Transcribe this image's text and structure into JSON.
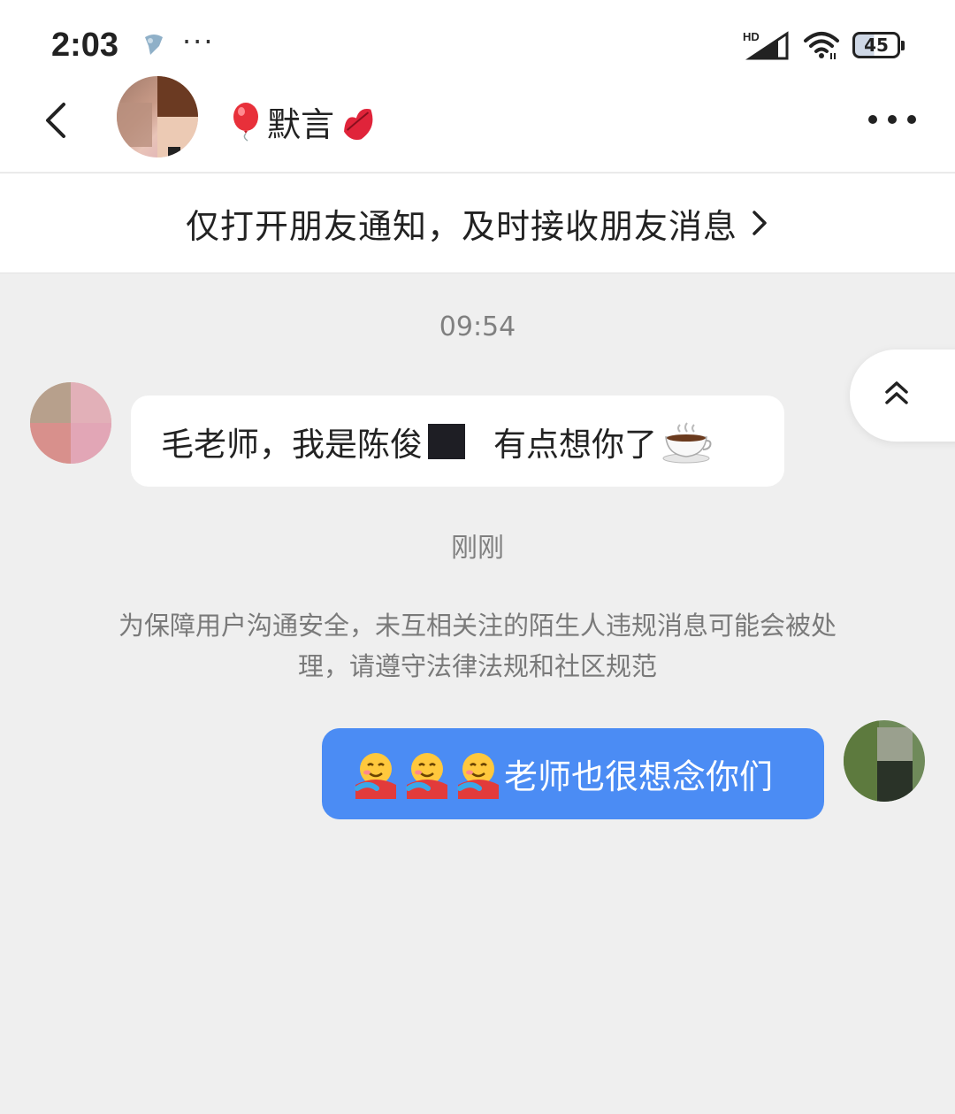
{
  "status_bar": {
    "time": "2:03",
    "more": "···",
    "network_label": "HD",
    "battery": "45"
  },
  "header": {
    "contact_name": "默言",
    "name_prefix_icon": "balloon-emoji",
    "name_suffix_icon": "lips-emoji"
  },
  "notice_bar": {
    "text": "仅打开朋友通知，及时接收朋友消息"
  },
  "chat": {
    "timestamp_1": "09:54",
    "incoming": {
      "text_before": "毛老师，我是陈俊",
      "text_after": "有点想你了",
      "trailing_icon": "hot-beverage-emoji"
    },
    "timestamp_2": "刚刚",
    "system_notice": "为保障用户沟通安全，未互相关注的陌生人违规消息可能会被处理，请遵守法律法规和社区规范",
    "outgoing": {
      "leading_icons": [
        "smiling-face-with-hearts-hug-emoji",
        "smiling-face-with-hearts-hug-emoji",
        "smiling-face-with-hearts-hug-emoji"
      ],
      "text": "老师也很想念你们"
    }
  },
  "colors": {
    "outgoing_bubble": "#4b8cf4",
    "incoming_bubble": "#ffffff",
    "background": "#efefef"
  }
}
